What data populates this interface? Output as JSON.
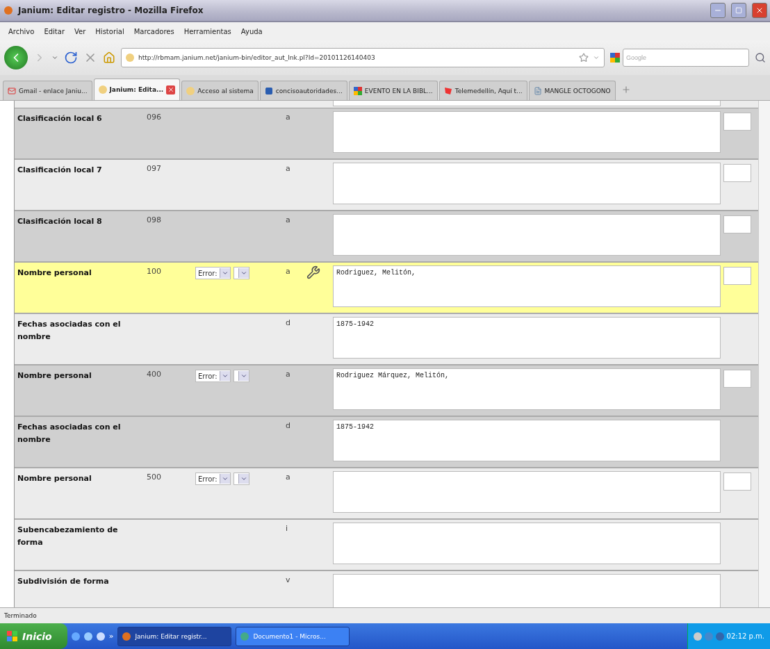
{
  "window": {
    "title": "Janium: Editar registro - Mozilla Firefox"
  },
  "menu": [
    "Archivo",
    "Editar",
    "Ver",
    "Historial",
    "Marcadores",
    "Herramientas",
    "Ayuda"
  ],
  "address": {
    "url": "http://rbmam.janium.net/janium-bin/editor_aut_lnk.pl?Id=20101126140403"
  },
  "search": {
    "placeholder": "Google"
  },
  "tabs": [
    {
      "label": "Gmail - enlace Janiu...",
      "selected": false
    },
    {
      "label": "Janium: Edita...",
      "selected": true
    },
    {
      "label": "Acceso al sistema",
      "selected": false
    },
    {
      "label": "concisoautoridades...",
      "selected": false
    },
    {
      "label": "EVENTO EN LA BIBL...",
      "selected": false
    },
    {
      "label": "Telemedellín, Aquí t...",
      "selected": false
    },
    {
      "label": "MANGLE OCTOGONO",
      "selected": false
    }
  ],
  "rows": [
    {
      "label": "Clasificación local 6",
      "tag": "096",
      "subfield": "a",
      "shaded": true,
      "highlighted": false,
      "side_box": true
    },
    {
      "label": "Clasificación local 7",
      "tag": "097",
      "subfield": "a",
      "shaded": false,
      "highlighted": false,
      "side_box": true
    },
    {
      "label": "Clasificación local 8",
      "tag": "098",
      "subfield": "a",
      "shaded": true,
      "highlighted": false,
      "side_box": true
    },
    {
      "label": "Nombre personal",
      "tag": "100",
      "status": "Error:",
      "subfield": "a",
      "tool_icon": true,
      "value": "Rodriguez, Melitón,",
      "highlighted": true,
      "side_box": true
    },
    {
      "label": "Fechas asociadas con el nombre",
      "subfield": "d",
      "value": "1875-1942",
      "shaded": false,
      "highlighted": false,
      "side_box": false
    },
    {
      "label": "Nombre personal",
      "tag": "400",
      "status": "Error:",
      "subfield": "a",
      "value": "Rodriguez Márquez, Melitón,",
      "shaded": true,
      "highlighted": false,
      "side_box": true
    },
    {
      "label": "Fechas asociadas con el nombre",
      "subfield": "d",
      "value": "1875-1942",
      "shaded": true,
      "highlighted": false,
      "side_box": false
    },
    {
      "label": "Nombre personal",
      "tag": "500",
      "status": "Error:",
      "subfield": "a",
      "shaded": false,
      "highlighted": false,
      "side_box": true
    },
    {
      "label": "Subencabezamiento de forma",
      "subfield": "i",
      "shaded": false,
      "highlighted": false,
      "side_box": false
    },
    {
      "label": "Subdivisión de forma",
      "subfield": "v",
      "shaded": false,
      "highlighted": false,
      "side_box": false
    }
  ],
  "status_bar": "Terminado",
  "taskbar": {
    "start": "Inicio",
    "more": "»",
    "tasks": [
      {
        "label": "Janium: Editar registr...",
        "selected": true
      },
      {
        "label": "Documento1 - Micros...",
        "selected": false
      }
    ],
    "clock": "02:12 p.m."
  }
}
